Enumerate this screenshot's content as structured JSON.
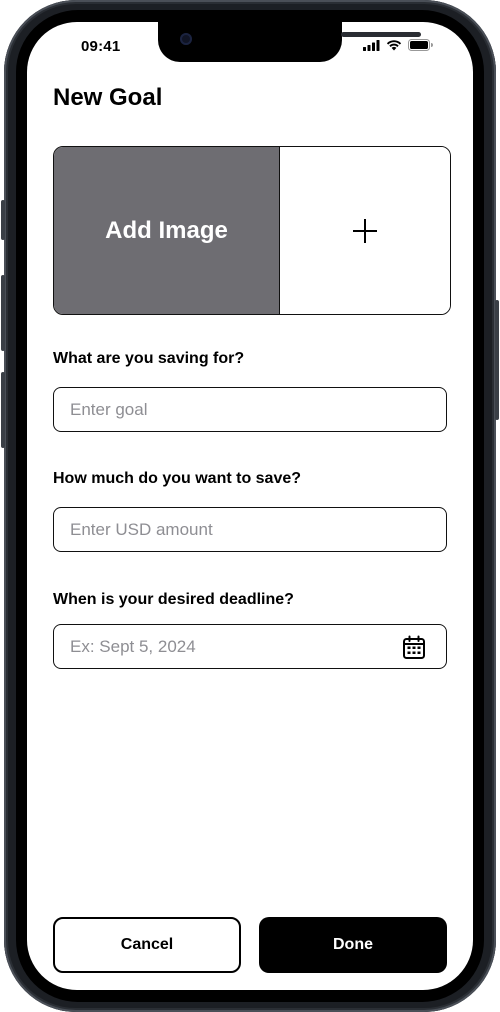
{
  "status_bar": {
    "time": "09:41",
    "icons": [
      "cellular-signal-icon",
      "wifi-icon",
      "battery-icon"
    ]
  },
  "page": {
    "title": "New Goal"
  },
  "image_picker": {
    "label": "Add Image",
    "icon": "plus-icon",
    "placeholder_color": "#6e6d72"
  },
  "form": {
    "goal": {
      "label": "What are you saving for?",
      "placeholder": "Enter goal",
      "value": ""
    },
    "amount": {
      "label": "How much do you want to save?",
      "placeholder": "Enter USD amount",
      "value": ""
    },
    "deadline": {
      "label": "When is your desired deadline?",
      "placeholder": "Ex: Sept 5, 2024",
      "value": "",
      "icon": "calendar-icon"
    }
  },
  "actions": {
    "cancel_label": "Cancel",
    "done_label": "Done"
  }
}
